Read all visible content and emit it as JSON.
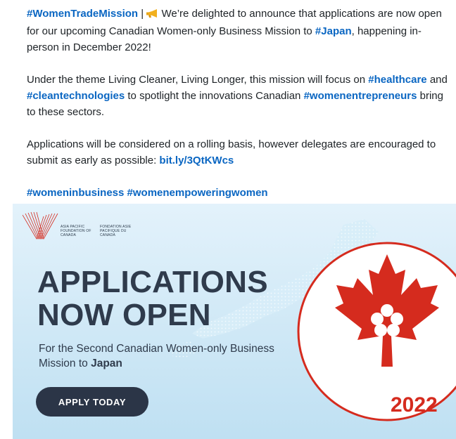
{
  "post": {
    "para1": {
      "tag": "#WomenTradeMission",
      "separator": " | ",
      "icon": "megaphone-icon",
      "text_a": " We’re delighted to announce that applications are now open for our upcoming Canadian Women-only Business Mission to ",
      "japan_tag": "#Japan",
      "text_b": ", happening in-person in December 2022!"
    },
    "para2": {
      "text_a": "Under the theme Living Cleaner, Living Longer, this mission will focus on ",
      "tag1": "#healthcare",
      "and": " and ",
      "tag2": "#cleantechnologies",
      "text_b": " to spotlight the innovations Canadian ",
      "tag3": "#womenentrepreneurs",
      "text_c": " bring to these sectors."
    },
    "para3": {
      "text": "Applications will be considered on a rolling basis, however delegates are encouraged to submit as early as possible: ",
      "link": "bit.ly/3QtKWcs"
    },
    "para4": {
      "tag1": "#womeninbusiness",
      "tag2": "#womenempoweringwomen"
    }
  },
  "banner": {
    "logo_en": "ASIA PACIFIC FOUNDATION OF CANADA",
    "logo_fr": "FONDATION ASIE PACIFIQUE DU CANADA",
    "headline_line1": "APPLICATIONS",
    "headline_line2": "NOW OPEN",
    "sub_text": "For the Second Canadian Women-only Business Mission to ",
    "sub_japan": "Japan",
    "button_label": "APPLY TODAY",
    "emblem_year": "2022",
    "colors": {
      "accent_red": "#d52b1e",
      "navy": "#2b3547",
      "link_blue": "#0a66c2"
    }
  }
}
